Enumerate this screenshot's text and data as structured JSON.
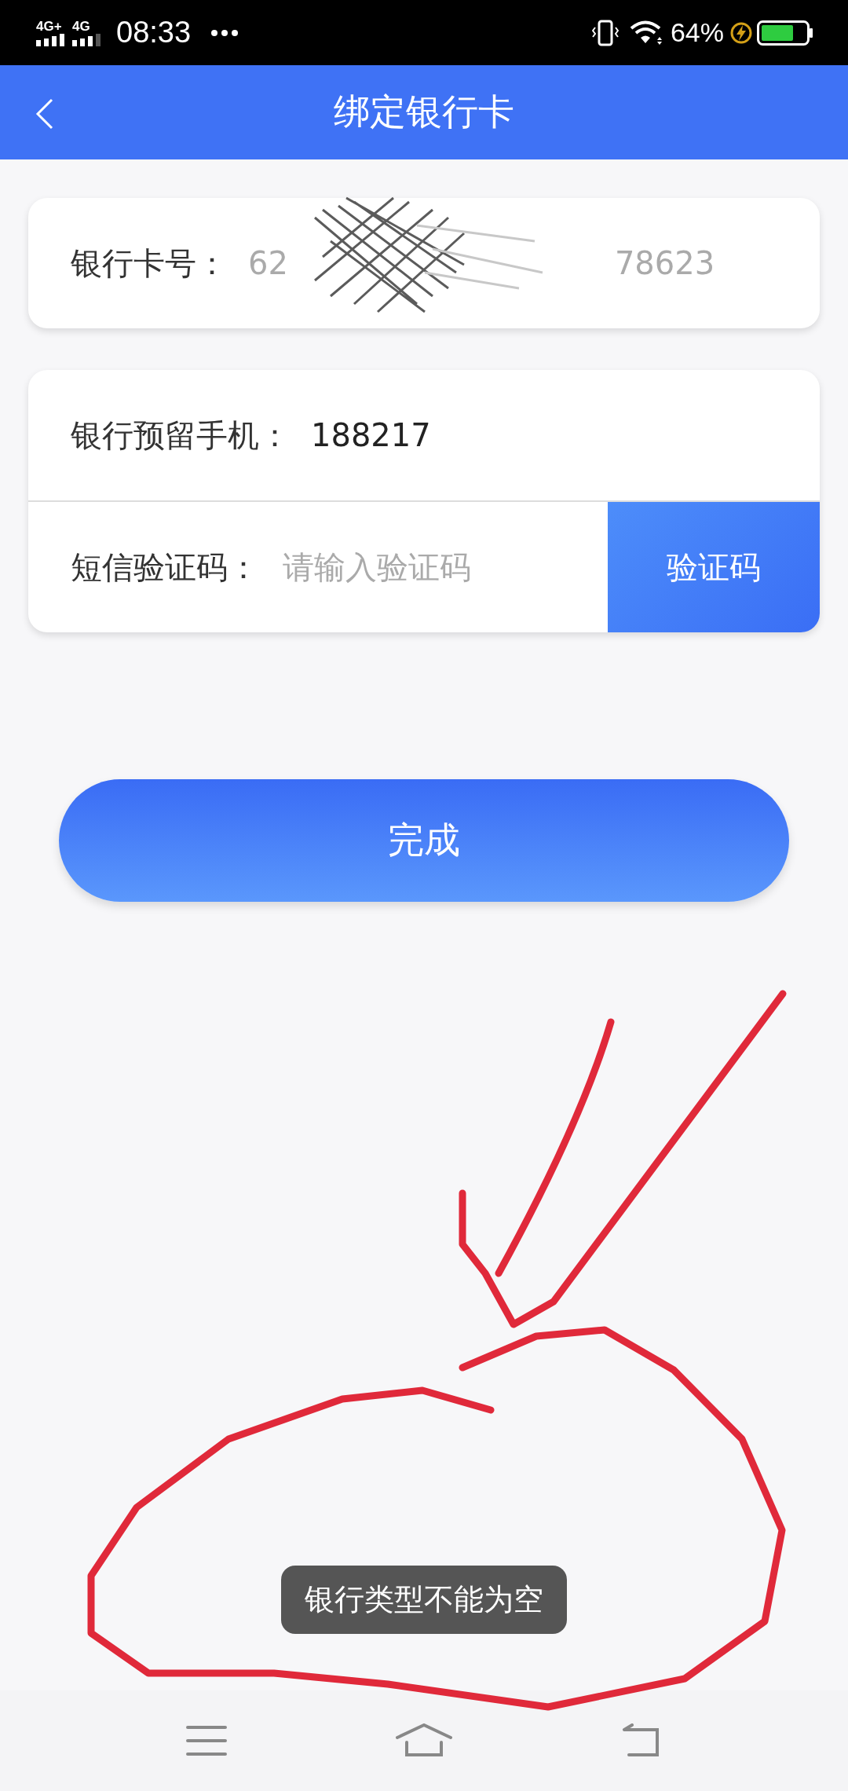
{
  "status_bar": {
    "signal_labels": [
      "4G+",
      "4G"
    ],
    "time": "08:33",
    "battery": "64%"
  },
  "header": {
    "title": "绑定银行卡"
  },
  "card_number": {
    "label": "银行卡号：",
    "value_start": "62",
    "value_end": "78623"
  },
  "phone": {
    "label": "银行预留手机：",
    "value": "188217"
  },
  "sms": {
    "label": "短信验证码：",
    "placeholder": "请输入验证码",
    "button": "验证码"
  },
  "submit": "完成",
  "toast": "银行类型不能为空"
}
